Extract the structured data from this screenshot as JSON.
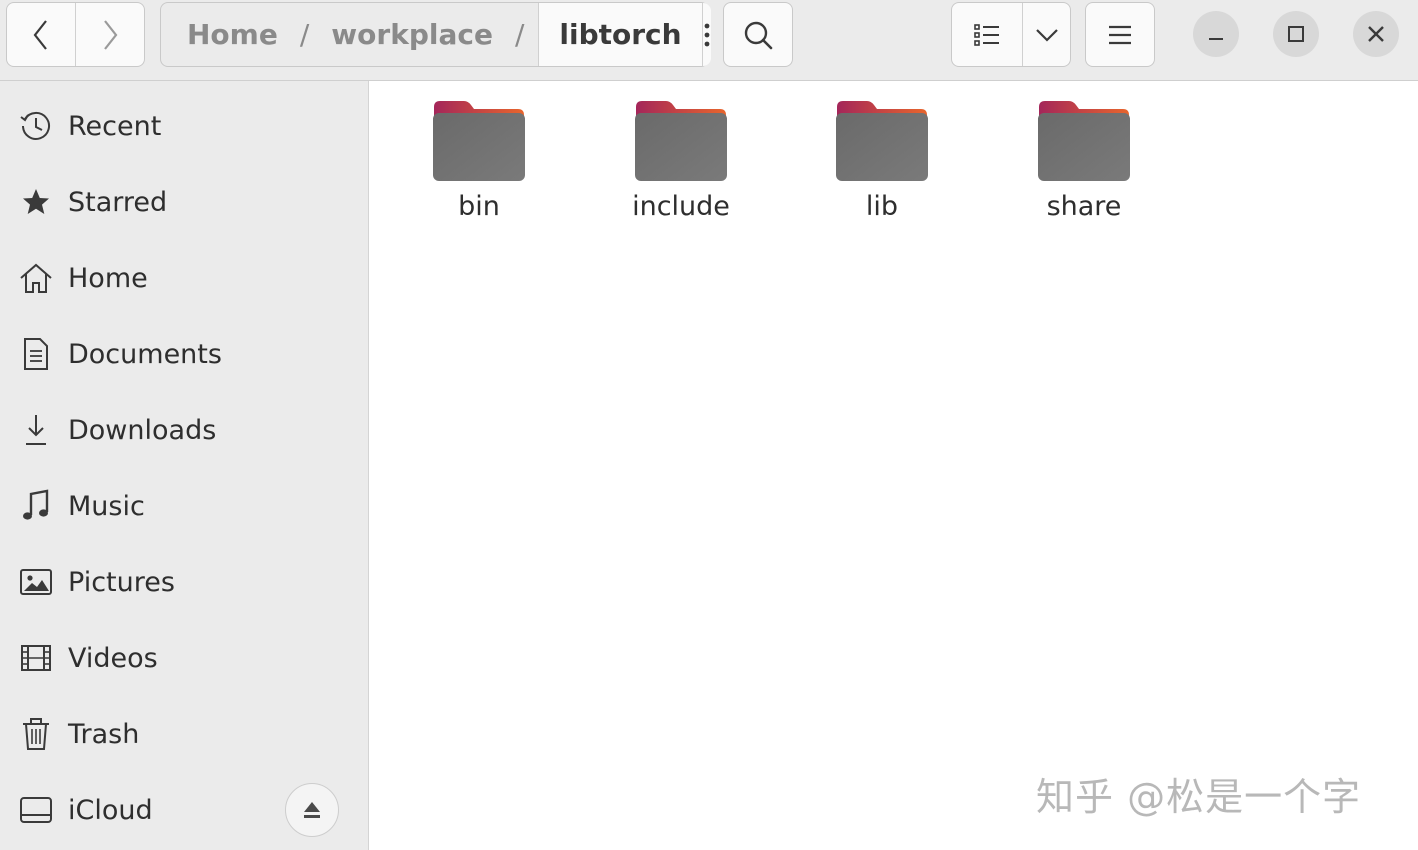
{
  "header": {
    "breadcrumb": [
      "Home",
      "workplace",
      "libtorch"
    ],
    "breadcrumb_separator": "/"
  },
  "sidebar": {
    "items": [
      {
        "label": "Recent",
        "icon": "clock-icon"
      },
      {
        "label": "Starred",
        "icon": "star-icon"
      },
      {
        "label": "Home",
        "icon": "home-icon"
      },
      {
        "label": "Documents",
        "icon": "document-icon"
      },
      {
        "label": "Downloads",
        "icon": "download-icon"
      },
      {
        "label": "Music",
        "icon": "music-note-icon"
      },
      {
        "label": "Pictures",
        "icon": "picture-icon"
      },
      {
        "label": "Videos",
        "icon": "film-icon"
      },
      {
        "label": "Trash",
        "icon": "trash-icon"
      },
      {
        "label": "iCloud",
        "icon": "drive-icon"
      }
    ]
  },
  "main": {
    "files": [
      {
        "name": "bin",
        "type": "folder"
      },
      {
        "name": "include",
        "type": "folder"
      },
      {
        "name": "lib",
        "type": "folder"
      },
      {
        "name": "share",
        "type": "folder"
      }
    ]
  },
  "colors": {
    "folder_body": "#6e6e6e",
    "folder_tab_start": "#a4265a",
    "folder_tab_end": "#e8652c",
    "sidebar_bg": "#ebebeb",
    "header_bg": "#ebebeb"
  },
  "watermark": "知乎 @松是一个字"
}
